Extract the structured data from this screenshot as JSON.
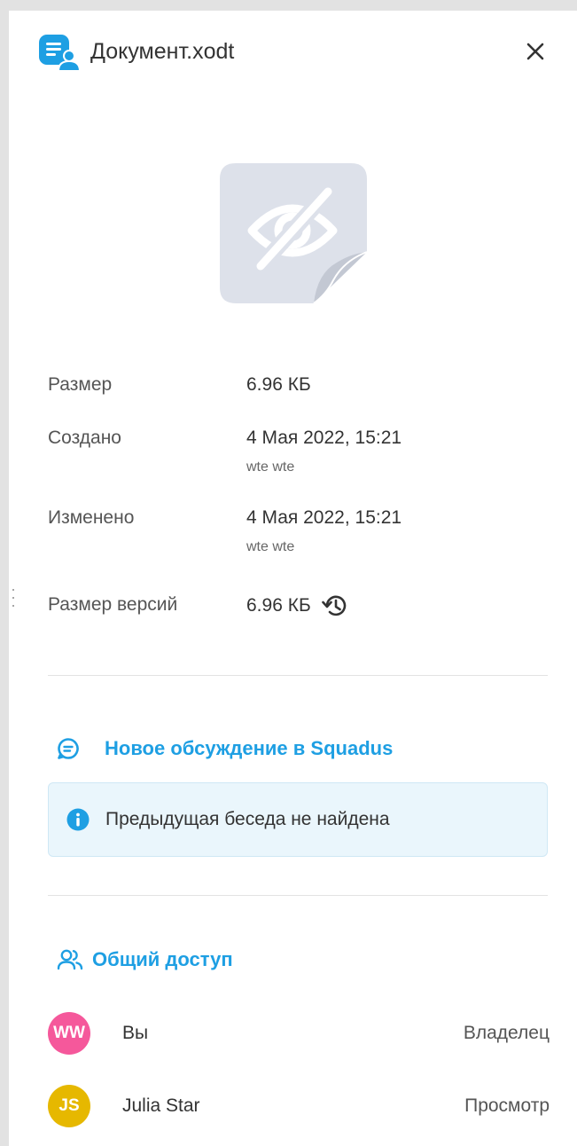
{
  "header": {
    "title": "Документ.xodt",
    "file_icon": "shared-document-icon",
    "close_icon": "close-icon"
  },
  "preview": {
    "icon": "no-preview-eye-slash-icon"
  },
  "properties": [
    {
      "label": "Размер",
      "value": "6.96 КБ",
      "sub": ""
    },
    {
      "label": "Создано",
      "value": "4 Мая 2022, 15:21",
      "sub": "wte wte"
    },
    {
      "label": "Изменено",
      "value": "4 Мая 2022, 15:21",
      "sub": "wte wte"
    },
    {
      "label": "Размер версий",
      "value": "6.96 КБ",
      "sub": "",
      "icon": "history-icon"
    }
  ],
  "discussion": {
    "link_label": "Новое обсуждение в Squadus",
    "info_text": "Предыдущая беседа не найдена"
  },
  "sharing": {
    "title": "Общий доступ",
    "members": [
      {
        "initials": "WW",
        "name": "Вы",
        "role": "Владелец",
        "color": "#f5589b"
      },
      {
        "initials": "JS",
        "name": "Julia Star",
        "role": "Просмотр",
        "color": "#e6b800"
      }
    ]
  },
  "colors": {
    "accent": "#1e9fe3",
    "info_bg": "#eaf6fc",
    "preview_bg": "#dde1ea"
  }
}
